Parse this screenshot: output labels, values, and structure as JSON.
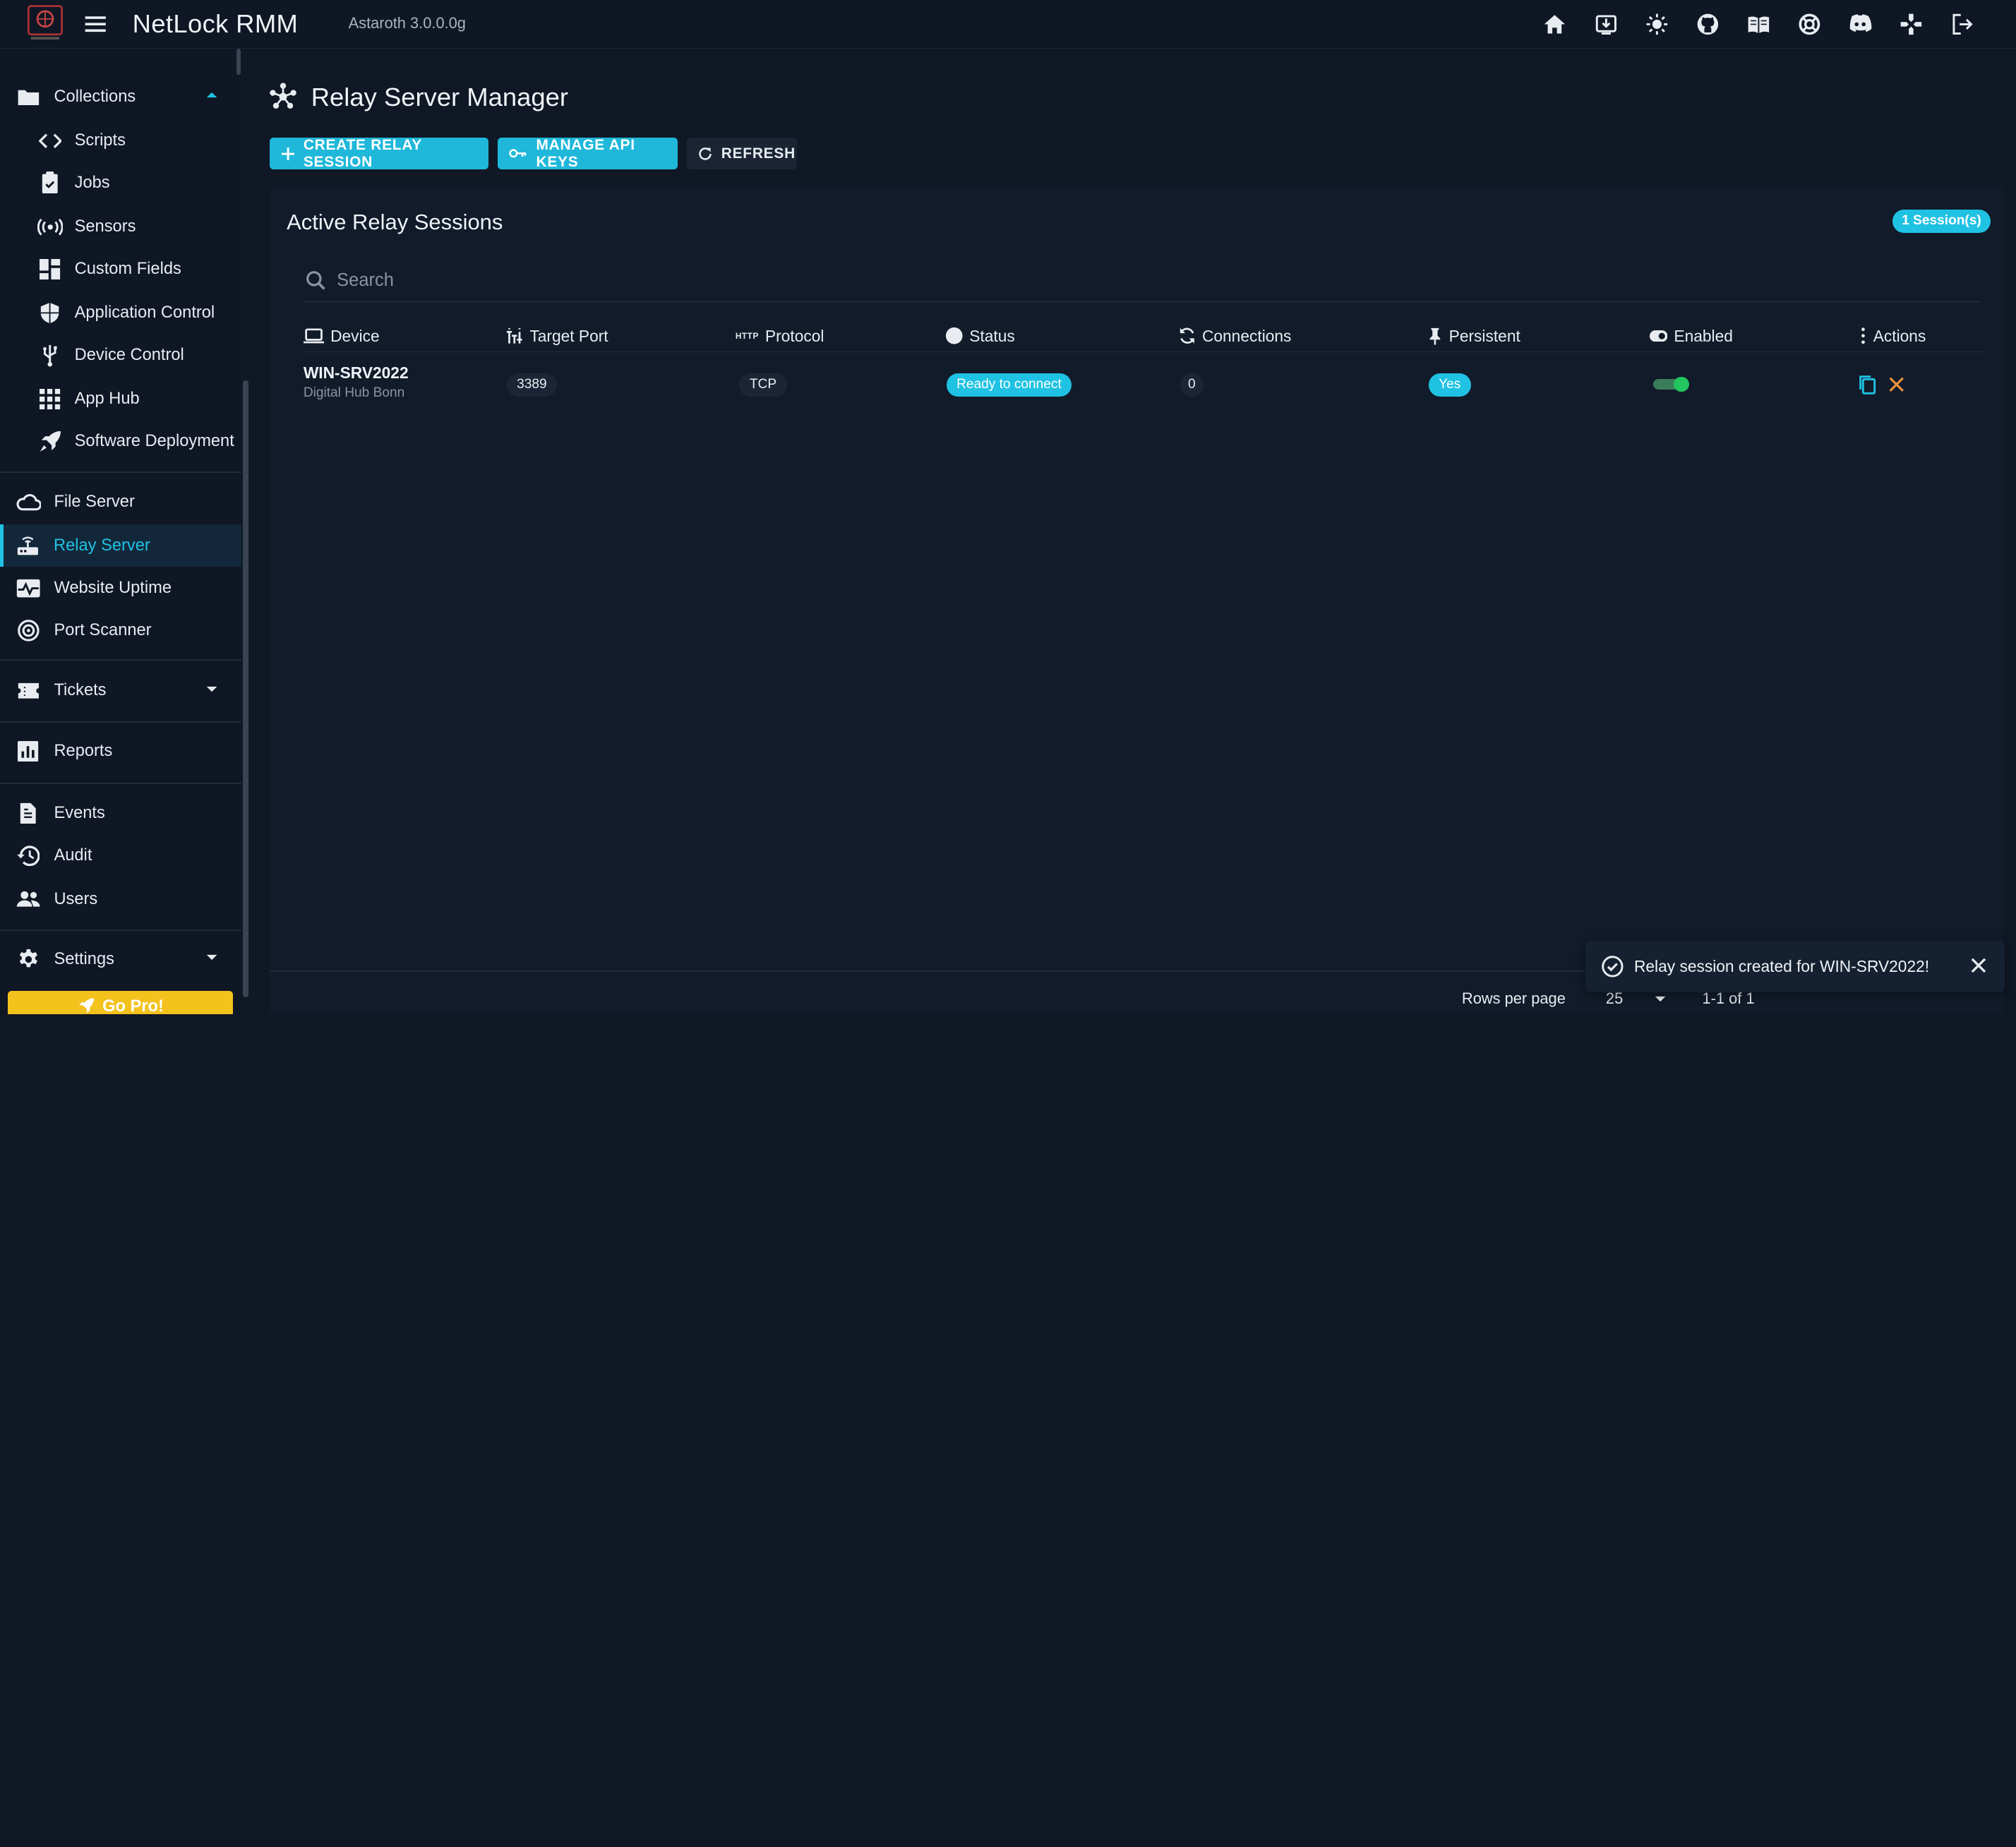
{
  "header": {
    "app_name": "NetLock RMM",
    "version": "Astaroth 3.0.0.0g",
    "icons": [
      "home-icon",
      "download-icon",
      "theme-toggle-icon",
      "github-icon",
      "docs-icon",
      "support-icon",
      "discord-icon",
      "games-icon",
      "logout-icon"
    ]
  },
  "sidebar": {
    "collections": "Collections",
    "scripts": "Scripts",
    "jobs": "Jobs",
    "sensors": "Sensors",
    "custom_fields": "Custom Fields",
    "application_control": "Application Control",
    "device_control": "Device Control",
    "app_hub": "App Hub",
    "software_deployment": "Software Deployment",
    "file_server": "File Server",
    "relay_server": "Relay Server",
    "website_uptime": "Website Uptime",
    "port_scanner": "Port Scanner",
    "tickets": "Tickets",
    "reports": "Reports",
    "events": "Events",
    "audit": "Audit",
    "users": "Users",
    "settings": "Settings",
    "go_pro": "Go Pro!"
  },
  "page": {
    "title": "Relay Server Manager",
    "buttons": {
      "create": "CREATE RELAY SESSION",
      "api_keys": "MANAGE API KEYS",
      "refresh": "REFRESH"
    }
  },
  "sessions": {
    "title": "Active Relay Sessions",
    "badge": "1 Session(s)",
    "search_placeholder": "Search",
    "columns": {
      "device": "Device",
      "target_port": "Target Port",
      "protocol": "Protocol",
      "protocol_icon": "HTTP",
      "status": "Status",
      "connections": "Connections",
      "persistent": "Persistent",
      "enabled": "Enabled",
      "actions": "Actions"
    },
    "rows": [
      {
        "device": "WIN-SRV2022",
        "location": "Digital Hub Bonn",
        "target_port": "3389",
        "protocol": "TCP",
        "status": "Ready to connect",
        "connections": "0",
        "persistent": "Yes",
        "enabled": true
      }
    ]
  },
  "pagination": {
    "rows_per_page_label": "Rows per page",
    "rows_per_page": "25",
    "range": "1-1 of 1"
  },
  "snackbar": {
    "message": "Relay session created for WIN-SRV2022!"
  },
  "colors": {
    "accent": "#1fc2e3",
    "background": "#101725",
    "enabled_toggle": "#22c55e",
    "delete_action": "#e8903a"
  }
}
